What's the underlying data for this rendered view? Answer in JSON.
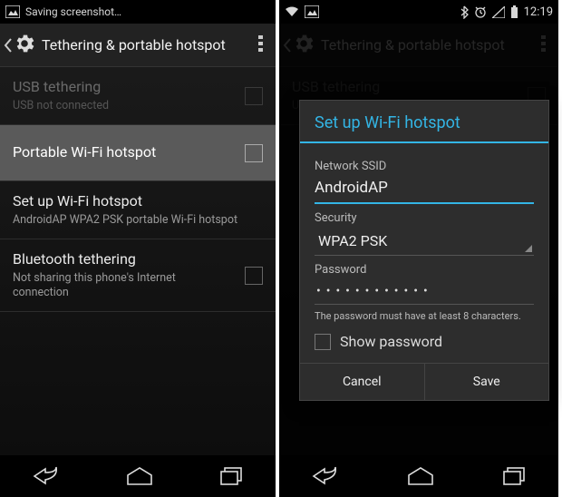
{
  "left": {
    "statusbar": {
      "text": "Saving screenshot…"
    },
    "actionbar": {
      "title": "Tethering & portable hotspot"
    },
    "rows": {
      "usb": {
        "title": "USB tethering",
        "sub": "USB not connected"
      },
      "portable": {
        "title": "Portable Wi-Fi hotspot"
      },
      "setup": {
        "title": "Set up Wi-Fi hotspot",
        "sub": "AndroidAP WPA2 PSK portable Wi-Fi hotspot"
      },
      "bt": {
        "title": "Bluetooth tethering",
        "sub": "Not sharing this phone's Internet connection"
      }
    }
  },
  "right": {
    "statusbar": {
      "time": "12:19"
    },
    "actionbar": {
      "title": "Tethering & portable hotspot"
    },
    "dialog": {
      "title": "Set up Wi-Fi hotspot",
      "ssid_label": "Network SSID",
      "ssid_value": "AndroidAP",
      "security_label": "Security",
      "security_value": "WPA2 PSK",
      "password_label": "Password",
      "password_value": "••••••••••••",
      "password_hint": "The password must have at least 8 characters.",
      "show_password": "Show password",
      "cancel": "Cancel",
      "save": "Save"
    }
  }
}
